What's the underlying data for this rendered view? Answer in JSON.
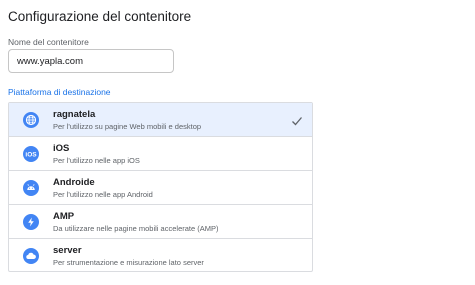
{
  "page": {
    "title": "Configurazione del contenitore"
  },
  "container_name": {
    "label": "Nome del contenitore",
    "value": "www.yapla.com"
  },
  "target_platform": {
    "label": "Piattaforma di destinazione",
    "selected": "ragnatela",
    "options": [
      {
        "name": "ragnatela",
        "description": "Per l'utilizzo su pagine Web mobili e desktop",
        "icon": "globe-icon"
      },
      {
        "name": "iOS",
        "description": "Per l'utilizzo nelle app iOS",
        "icon": "ios-icon"
      },
      {
        "name": "Androide",
        "description": "Per l'utilizzo nelle app Android",
        "icon": "android-icon"
      },
      {
        "name": "AMP",
        "description": "Da utilizzare nelle pagine mobili accelerate (AMP)",
        "icon": "amp-bolt-icon"
      },
      {
        "name": "server",
        "description": "Per strumentazione e misurazione lato server",
        "icon": "cloud-icon"
      }
    ]
  },
  "colors": {
    "accent": "#1a73e8",
    "icon_bg": "#4285f4",
    "selected_bg": "#e8f0fe",
    "border": "#dadce0"
  }
}
